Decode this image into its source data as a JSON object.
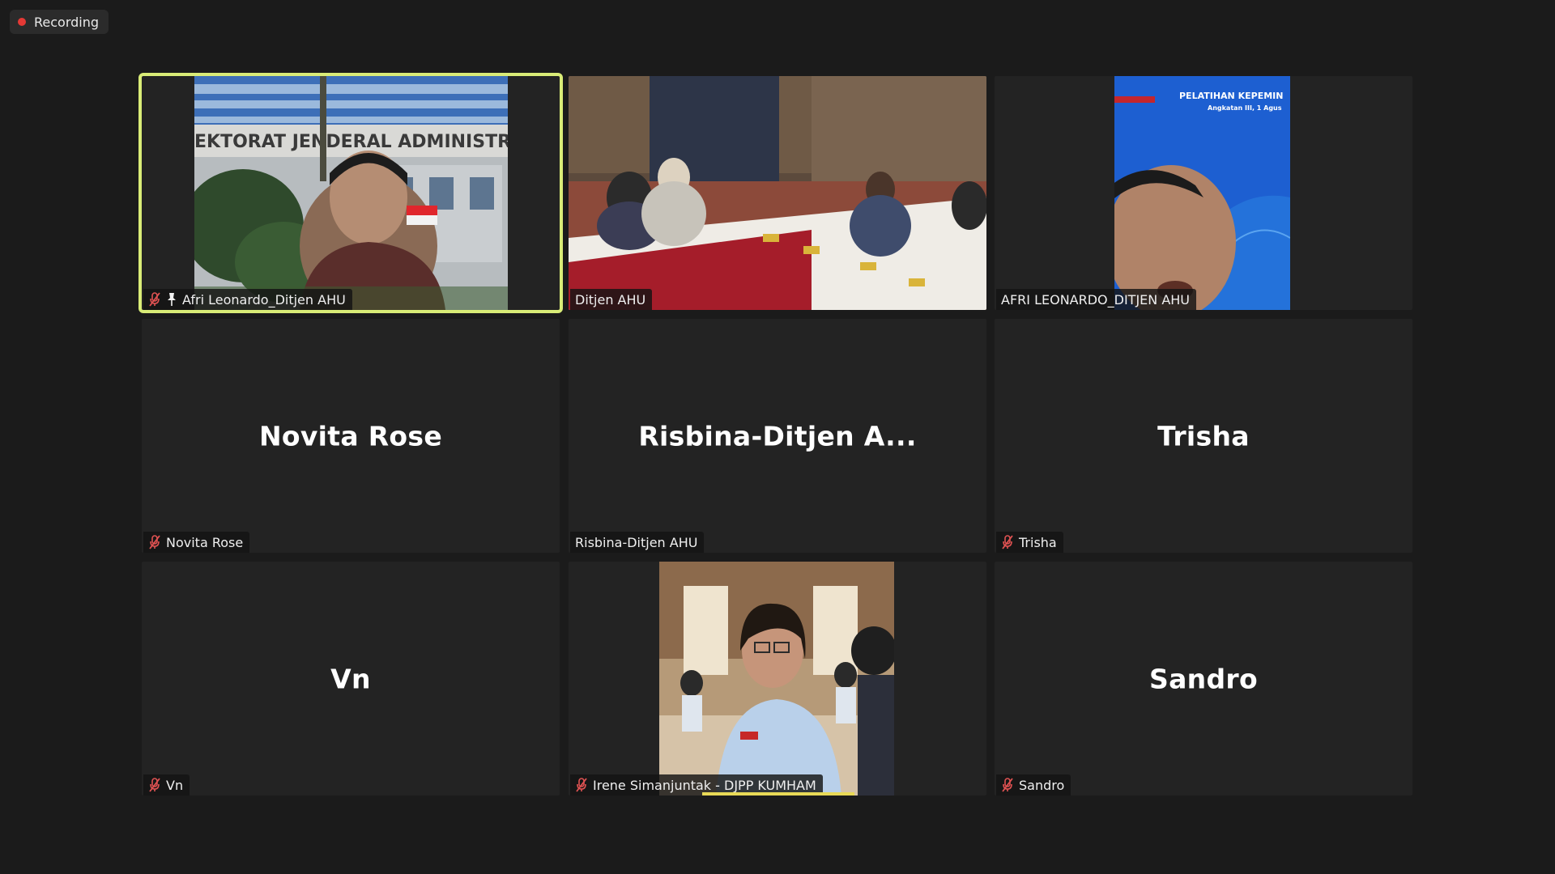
{
  "recording": {
    "label": "Recording",
    "color": "#e53935"
  },
  "tiles": [
    {
      "display_name": "Afri Leonardo_Ditjen AHU",
      "muted": true,
      "pinned": true,
      "video": "building-photo",
      "overlay_text": "EKTORAT JENDERAL ADMINISTRASI HUKU",
      "active_speaker": true
    },
    {
      "display_name": "Ditjen AHU",
      "muted": false,
      "video": "meeting-room"
    },
    {
      "display_name": "AFRI LEONARDO_DITJEN AHU",
      "muted": false,
      "video": "slide-face",
      "slide_title": "PELATIHAN KEPEMIN",
      "slide_subtitle": "Angkatan III, 1 Agus"
    },
    {
      "display_name": "Novita Rose",
      "big_name": "Novita Rose",
      "muted": true
    },
    {
      "display_name": "Risbina-Ditjen AHU",
      "big_name": "Risbina-Ditjen  A...",
      "muted": false
    },
    {
      "display_name": "Trisha",
      "big_name": "Trisha",
      "muted": true
    },
    {
      "display_name": "Vn",
      "big_name": "Vn",
      "muted": true
    },
    {
      "display_name": "Irene Simanjuntak - DJPP KUMHAM",
      "muted": true,
      "video": "woman-portrait"
    },
    {
      "display_name": "Sandro",
      "big_name": "Sandro",
      "muted": true
    }
  ],
  "colors": {
    "active_outline": "#d9ec77",
    "muted_icon": "#e05252",
    "background": "#1b1b1b",
    "tile": "#232323"
  }
}
